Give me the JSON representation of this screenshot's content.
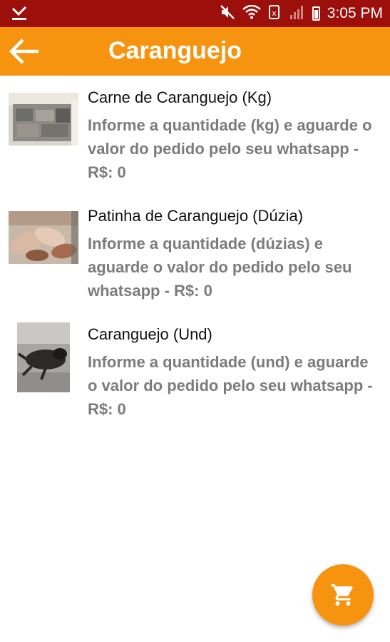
{
  "status_bar": {
    "time": "3:05 PM",
    "icons": [
      "download-done-icon",
      "mute-icon",
      "wifi-icon",
      "data-saver-icon",
      "signal-icon",
      "battery-icon"
    ]
  },
  "app_bar": {
    "back_icon": "arrow-back-icon",
    "title": "Caranguejo"
  },
  "products": [
    {
      "title": "Carne de Caranguejo (Kg)",
      "description": "Informe a quantidade (kg) e aguarde o valor do pedido pelo seu whatsapp - R$: 0"
    },
    {
      "title": "Patinha de Caranguejo (Dúzia)",
      "description": "Informe a quantidade (dúzias) e aguarde o valor do pedido pelo seu whatsapp - R$: 0"
    },
    {
      "title": "Caranguejo (Und)",
      "description": "Informe a quantidade (und) e aguarde o valor do pedido pelo seu whatsapp - R$: 0"
    }
  ],
  "fab": {
    "icon": "shopping-cart-icon"
  },
  "colors": {
    "status_bar": "#9c0f0b",
    "app_bar": "#f7940f",
    "accent": "#f7940f",
    "description_text": "#7c7c7c"
  }
}
